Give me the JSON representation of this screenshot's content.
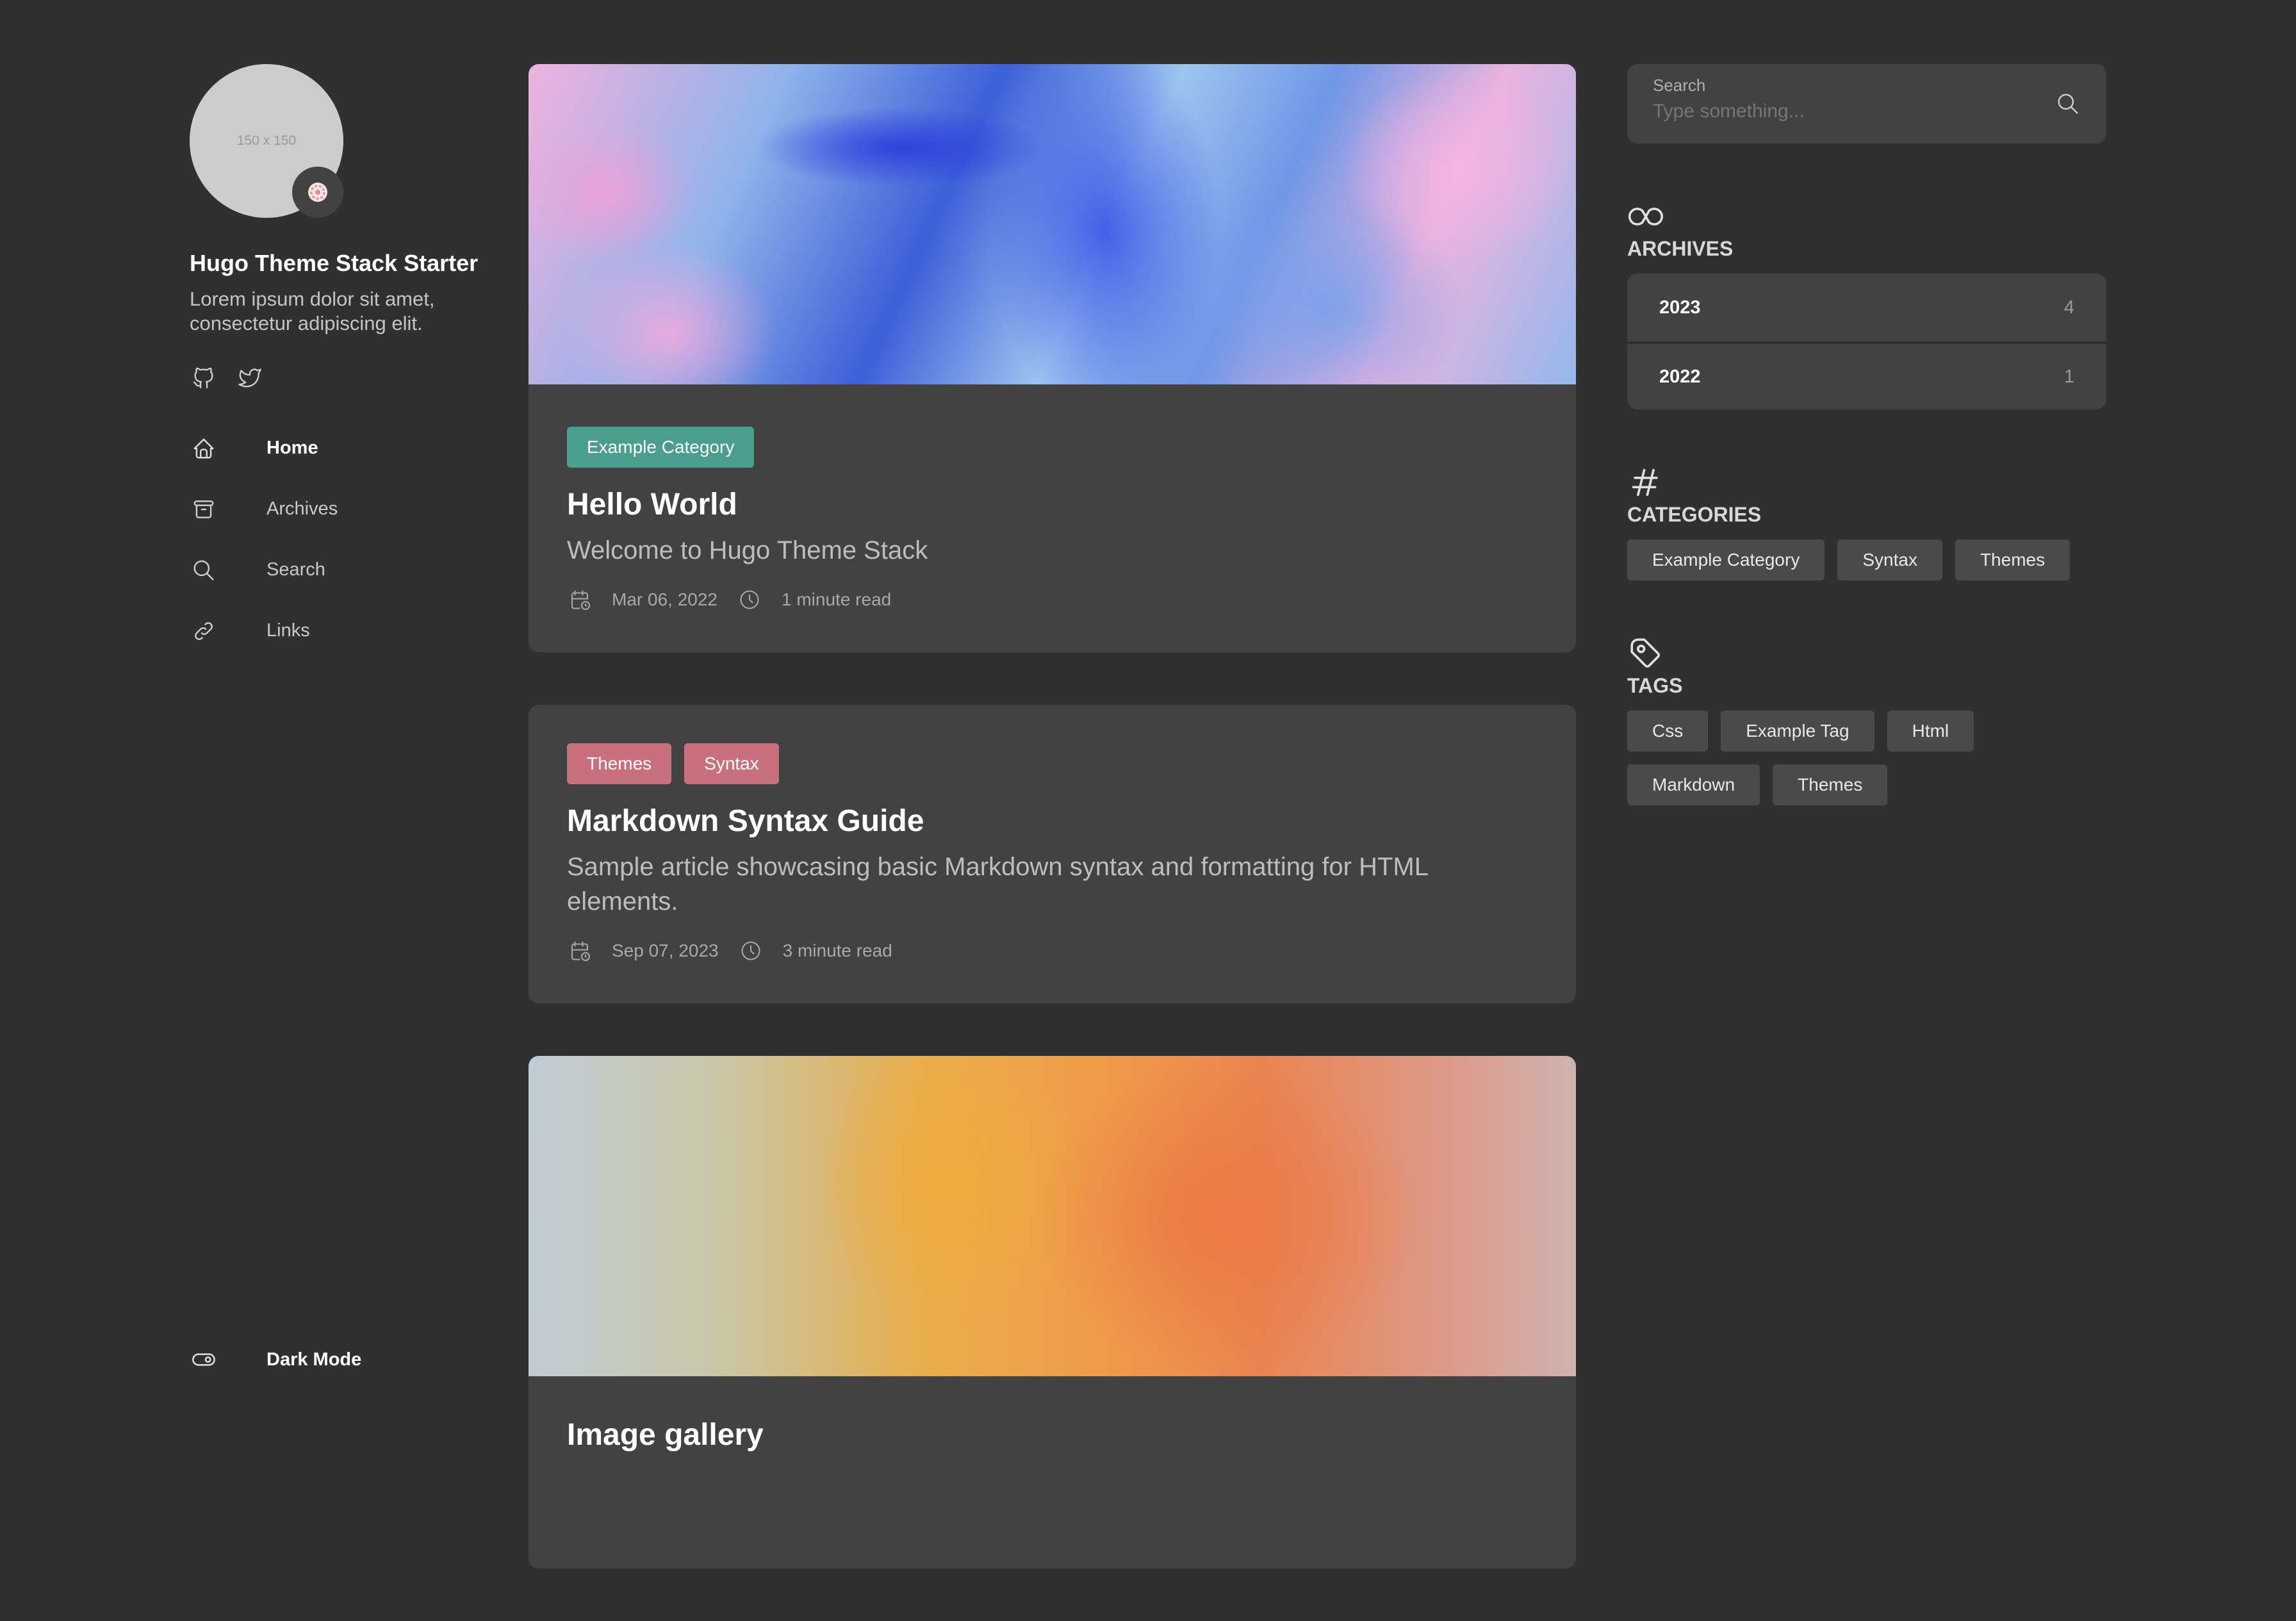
{
  "sidebar": {
    "avatar_placeholder": "150 x 150",
    "emoji": "🍥",
    "site_name": "Hugo Theme Stack Starter",
    "description": "Lorem ipsum dolor sit amet, consectetur adipiscing elit.",
    "social": [
      "github-icon",
      "twitter-icon"
    ],
    "menu": [
      {
        "label": "Home",
        "icon": "home-icon",
        "active": true
      },
      {
        "label": "Archives",
        "icon": "archive-icon",
        "active": false
      },
      {
        "label": "Search",
        "icon": "search-icon",
        "active": false
      },
      {
        "label": "Links",
        "icon": "link-icon",
        "active": false
      }
    ],
    "dark_mode_label": "Dark Mode"
  },
  "posts": [
    {
      "categories": [
        {
          "label": "Example Category",
          "color": "#4a9e8e"
        }
      ],
      "title": "Hello World",
      "subtitle": "Welcome to Hugo Theme Stack",
      "date": "Mar 06, 2022",
      "read_time": "1 minute read"
    },
    {
      "categories": [
        {
          "label": "Themes",
          "color": "#c8707e"
        },
        {
          "label": "Syntax",
          "color": "#c8707e"
        }
      ],
      "title": "Markdown Syntax Guide",
      "subtitle": "Sample article showcasing basic Markdown syntax and formatting for HTML elements.",
      "date": "Sep 07, 2023",
      "read_time": "3 minute read"
    },
    {
      "title": "Image gallery"
    }
  ],
  "search": {
    "label": "Search",
    "placeholder": "Type something..."
  },
  "archives": {
    "title": "ARCHIVES",
    "items": [
      {
        "year": "2023",
        "count": "4"
      },
      {
        "year": "2022",
        "count": "1"
      }
    ]
  },
  "categories": {
    "title": "CATEGORIES",
    "items": [
      "Example Category",
      "Syntax",
      "Themes"
    ]
  },
  "tags": {
    "title": "TAGS",
    "items": [
      "Css",
      "Example Tag",
      "Html",
      "Markdown",
      "Themes"
    ]
  }
}
